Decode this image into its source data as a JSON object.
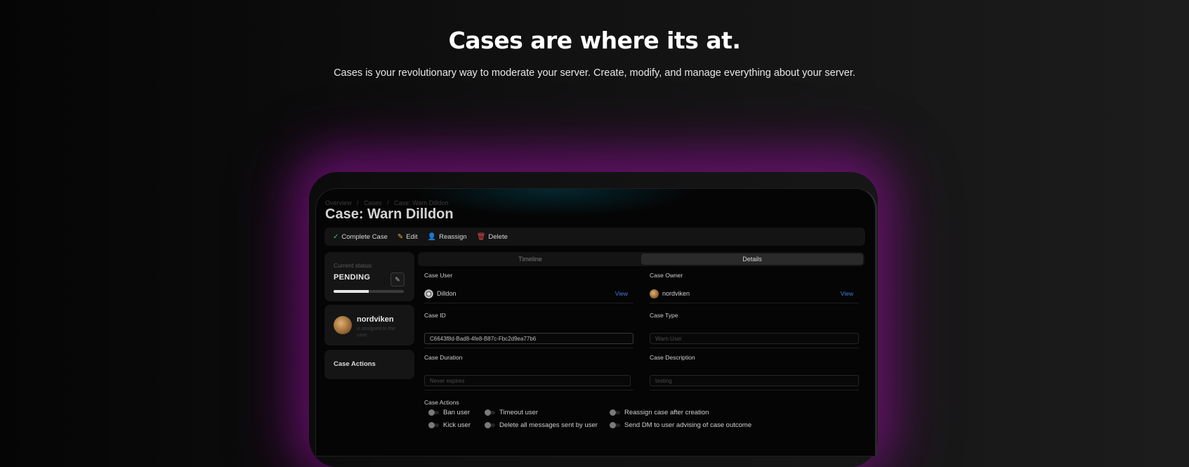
{
  "hero": {
    "title": "Cases are where its at.",
    "subtitle": "Cases is your revolutionary way to moderate your server. Create, modify, and manage everything about your server."
  },
  "app": {
    "breadcrumbs": [
      "Overview",
      "/",
      "Cases",
      "/",
      "Case: Warn Dilldon"
    ],
    "page_title": "Case: Warn Dilldon",
    "toolbar": {
      "complete": "Complete Case",
      "edit": "Edit",
      "reassign": "Reassign",
      "delete": "Delete"
    },
    "status": {
      "label": "Current status:",
      "value": "PENDING",
      "progress_percent": 50
    },
    "assignee": {
      "name": "nordviken",
      "subtitle": "is assigned to the case"
    },
    "actions_card": "Case Actions",
    "tabs": [
      {
        "label": "Timeline",
        "active": false
      },
      {
        "label": "Details",
        "active": true
      }
    ],
    "details": {
      "case_user_label": "Case User",
      "case_user": "Dilldon",
      "case_owner_label": "Case Owner",
      "case_owner": "nordviken",
      "view_link": "View",
      "case_id_label": "Case ID",
      "case_id": "C6643f8d-Bad8-4fe8-B87c-Fbc2d9ea77b6",
      "case_type_label": "Case Type",
      "case_type": "Warn User",
      "case_duration_label": "Case Duration",
      "case_duration": "Never expires",
      "case_description_label": "Case Description",
      "case_description": "testing",
      "case_actions_label": "Case Actions",
      "actions": [
        "Ban user",
        "Timeout user",
        "Reassign case after creation",
        "Kick user",
        "Delete all messages sent by user",
        "Send DM to user advising of case outcome"
      ]
    },
    "colors": {
      "glow": "#9614a0",
      "link": "#3f7fd8",
      "complete_icon": "#3fbf6a",
      "edit_icon": "#e0b03a",
      "reassign_icon": "#5aa0e0",
      "delete_icon": "#e04848"
    }
  }
}
